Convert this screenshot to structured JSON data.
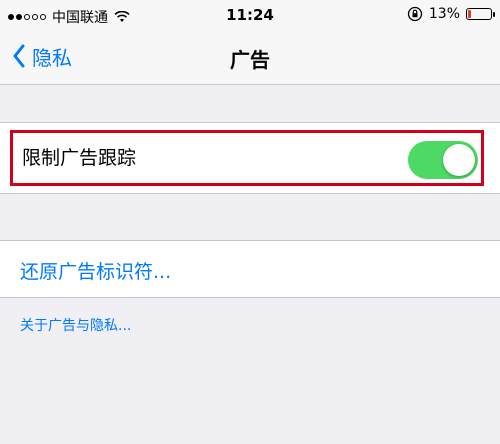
{
  "status_bar": {
    "carrier": "中国联通",
    "time": "11:24",
    "battery_percent": "13%",
    "battery_level": 0.13,
    "battery_color": "#e53935",
    "signal_strength": 2,
    "icons": [
      "signal-dots-icon",
      "wifi-icon",
      "lock-rotation-icon",
      "battery-icon"
    ]
  },
  "nav": {
    "back_label": "隐私",
    "title": "广告",
    "back_icon": "chevron-left-icon"
  },
  "settings": {
    "limit_ad_tracking": {
      "label": "限制广告跟踪",
      "enabled": true,
      "toggle_color": "#4cd964"
    },
    "reset_identifier": {
      "label": "还原广告标识符..."
    },
    "about_link": "关于广告与隐私..."
  },
  "colors": {
    "accent": "#007aff",
    "highlight": "#d0021b",
    "background": "#efeff4"
  }
}
